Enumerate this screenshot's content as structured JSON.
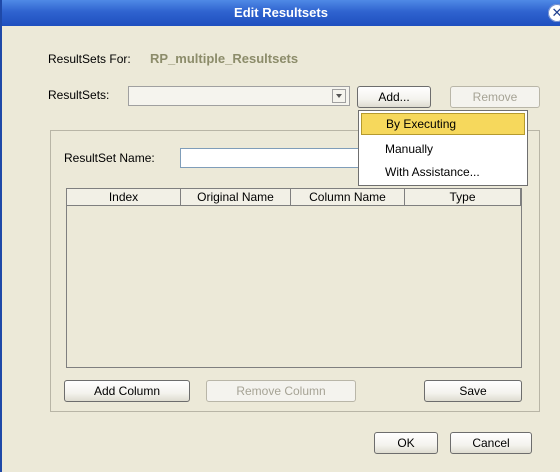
{
  "window": {
    "title": "Edit Resultsets",
    "close_glyph": "✕"
  },
  "header": {
    "resultsets_for_label": "ResultSets For:",
    "resultsets_for_value": "RP_multiple_Resultsets",
    "resultsets_label": "ResultSets:"
  },
  "buttons": {
    "add": "Add...",
    "remove": "Remove",
    "add_column": "Add Column",
    "remove_column": "Remove Column",
    "save": "Save",
    "ok": "OK",
    "cancel": "Cancel"
  },
  "add_menu": {
    "items": [
      "By Executing",
      "Manually",
      "With Assistance..."
    ],
    "selected": "By Executing"
  },
  "editor": {
    "resultset_name_label": "ResultSet Name:"
  },
  "table": {
    "columns": [
      "Index",
      "Original Name",
      "Column Name",
      "Type"
    ]
  },
  "icons": {
    "close": "close-icon",
    "dropdown": "chevron-down-icon"
  }
}
